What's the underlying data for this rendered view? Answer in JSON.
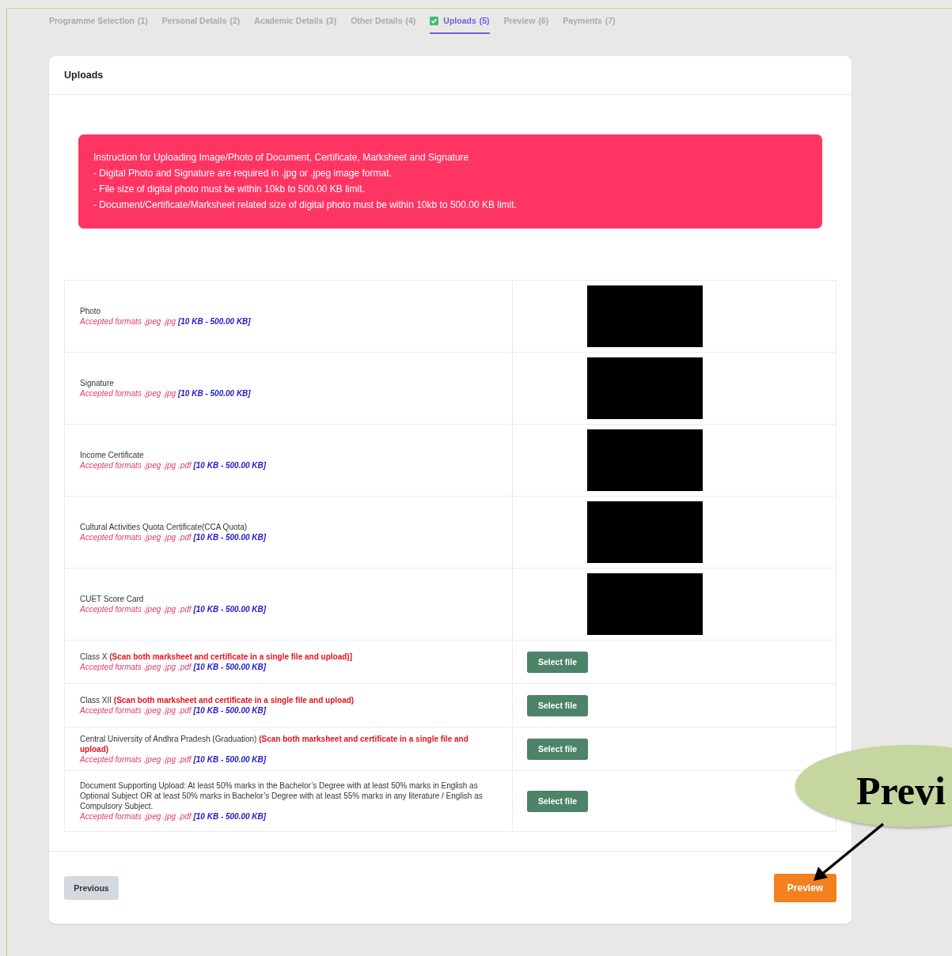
{
  "tabs": [
    {
      "label": "Programme Selection",
      "step": "(1)",
      "selected": false,
      "checked": false
    },
    {
      "label": "Personal Details",
      "step": "(2)",
      "selected": false,
      "checked": false
    },
    {
      "label": "Academic Details",
      "step": "(3)",
      "selected": false,
      "checked": false
    },
    {
      "label": "Other Details",
      "step": "(4)",
      "selected": false,
      "checked": false
    },
    {
      "label": "Uploads",
      "step": "(5)",
      "selected": true,
      "checked": true
    },
    {
      "label": "Preview",
      "step": "(6)",
      "selected": false,
      "checked": false
    },
    {
      "label": "Payments",
      "step": "(7)",
      "selected": false,
      "checked": false
    }
  ],
  "card": {
    "title": "Uploads",
    "instructions": [
      "Instruction for Uploading Image/Photo of Document, Certificate, Marksheet and Signature",
      "- Digital Photo and Signature are required in .jpg or .jpeg image format.",
      "- File size of digital photo must be within 10kb to 500.00 KB limit.",
      "- Document/Certificate/Marksheet related size of digital photo must be within 10kb to 500.00 KB limit."
    ],
    "uploads": [
      {
        "kind": "redacted",
        "label": "Photo",
        "formats": "Accepted formats .jpeg .jpg",
        "size": "[10 KB - 500.00 KB]"
      },
      {
        "kind": "redacted",
        "label": "Signature",
        "formats": "Accepted formats .jpeg .jpg",
        "size": "[10 KB - 500.00 KB]"
      },
      {
        "kind": "redacted",
        "label": "Income Certificate",
        "formats": "Accepted formats .jpeg .jpg .pdf",
        "size": "[10 KB - 500.00 KB]"
      },
      {
        "kind": "redacted",
        "label": "Cultural Activities Quota Certificate(CCA Quota)",
        "formats": "Accepted formats .jpeg .jpg .pdf",
        "size": "[10 KB - 500.00 KB]"
      },
      {
        "kind": "redacted",
        "label": "CUET Score Card",
        "formats": "Accepted formats .jpeg .jpg .pdf",
        "size": "[10 KB - 500.00 KB]"
      },
      {
        "kind": "button",
        "label": "Class X",
        "note": "(Scan both marksheet and certificate in a single file and upload)]",
        "formats": "Accepted formats .jpeg .jpg .pdf",
        "size": "[10 KB - 500.00 KB]",
        "button": "Select file"
      },
      {
        "kind": "button",
        "label": "Class XII",
        "note": "(Scan both marksheet and certificate in a single file and upload)",
        "formats": "Accepted formats .jpeg .jpg .pdf",
        "size": "[10 KB - 500.00 KB]",
        "button": "Select file"
      },
      {
        "kind": "button",
        "label": "Central University of Andhra Pradesh (Graduation)",
        "note": "(Scan both marksheet and certificate in a single file and upload)",
        "formats": "Accepted formats .jpeg .jpg .pdf",
        "size": "[10 KB - 500.00 KB]",
        "button": "Select file"
      },
      {
        "kind": "button",
        "label": "Document Supporting Upload: At least 50% marks in the Bachelor’s Degree with at least 50% marks in English as Optional Subject OR at least 50% marks in Bachelor’s Degree with at least 55% marks in any literature / English as Compulsory Subject.",
        "formats": "Accepted formats .jpeg .jpg .pdf",
        "size": "[10 KB - 500.00 KB]",
        "button": "Select file"
      }
    ],
    "previous_button": "Previous",
    "preview_button": "Preview"
  },
  "callout": {
    "text": "Previ"
  }
}
